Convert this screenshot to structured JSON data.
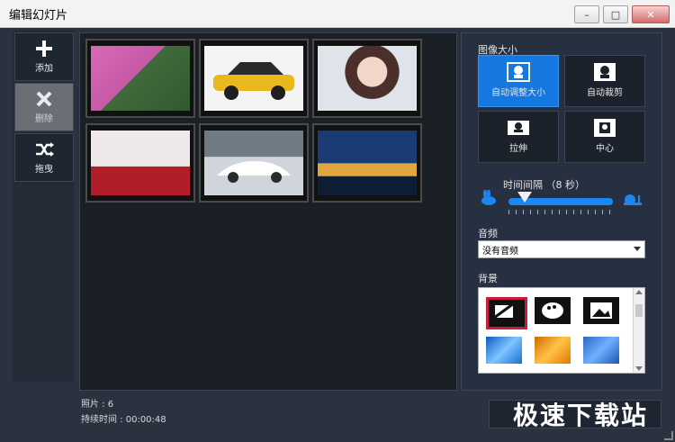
{
  "window": {
    "title": "编辑幻灯片"
  },
  "toolbar": {
    "add_label": "添加",
    "delete_label": "删除",
    "drag_label": "拖曳"
  },
  "photos": [
    {
      "name": "photo-aerial-road-forest"
    },
    {
      "name": "photo-yellow-suv"
    },
    {
      "name": "photo-portrait-woman"
    },
    {
      "name": "photo-woman-red-dress"
    },
    {
      "name": "photo-white-sportscar"
    },
    {
      "name": "photo-night-city"
    }
  ],
  "info": {
    "count_label": "照片 : 6",
    "duration_label": "持续时间 : 00:00:48"
  },
  "image_size": {
    "title": "图像大小",
    "options": [
      {
        "label": "自动调整大小",
        "icon": "fit-icon",
        "active": true
      },
      {
        "label": "自动裁剪",
        "icon": "crop-icon",
        "active": false
      },
      {
        "label": "拉伸",
        "icon": "stretch-icon",
        "active": false
      },
      {
        "label": "中心",
        "icon": "center-icon",
        "active": false
      }
    ]
  },
  "interval": {
    "label": "时间间隔  （8 秒）",
    "value": 8
  },
  "audio": {
    "title": "音频",
    "selected": "没有音频"
  },
  "background": {
    "title": "背景"
  },
  "watermark": {
    "text": "极速下载站"
  },
  "colors": {
    "accent": "#1577e0",
    "panel": "#2a3240"
  }
}
